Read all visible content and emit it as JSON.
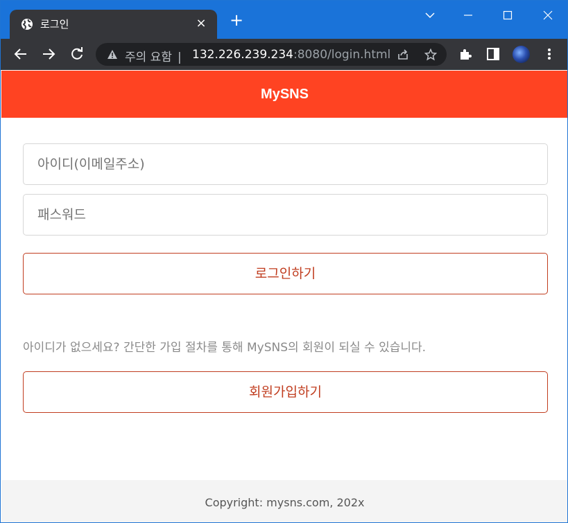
{
  "browser": {
    "tab_title": "로그인",
    "tab_close": "×",
    "new_tab": "+",
    "security_label": "주의 요함",
    "url_host": "132.226.239.234",
    "url_rest": ":8080/login.html"
  },
  "page": {
    "brand": "MySNS",
    "id_placeholder": "아이디(이메일주소)",
    "password_placeholder": "패스워드",
    "login_button": "로그인하기",
    "signup_prompt": "아이디가 없으세요? 간단한 가입 절차를 통해 MySNS의 회원이 되실 수 있습니다.",
    "signup_button": "회원가입하기",
    "footer": "Copyright: mysns.com, 202x"
  },
  "colors": {
    "header_bg": "#ff4322",
    "button_accent": "#c03c1e",
    "titlebar": "#1a73d9",
    "toolbar": "#35363a"
  }
}
